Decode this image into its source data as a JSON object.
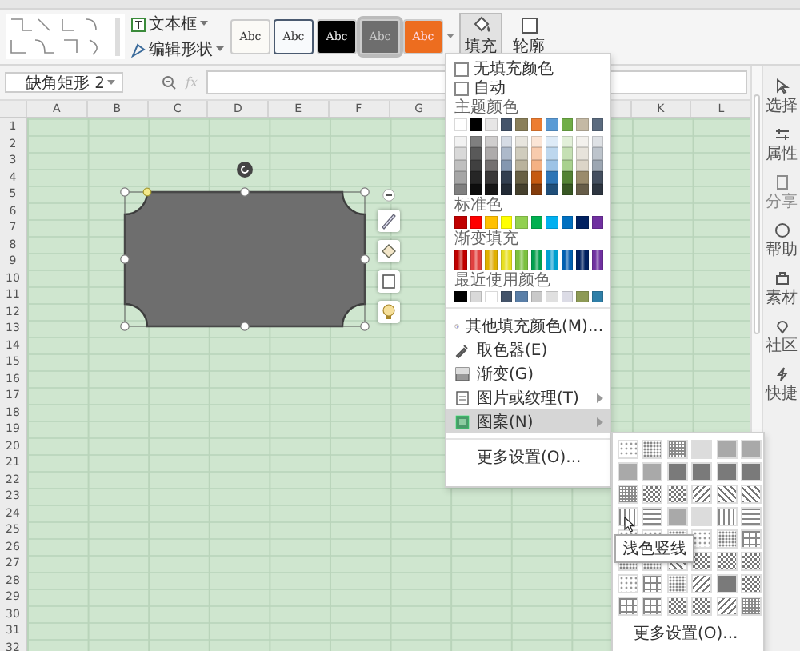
{
  "ribbon": {
    "tools": [
      {
        "label": "文本框",
        "kind": "textbox"
      },
      {
        "label": "编辑形状",
        "kind": "edit"
      }
    ],
    "styles": [
      {
        "label": "Abc",
        "kind": "light",
        "selected": false
      },
      {
        "label": "Abc",
        "kind": "outline",
        "selected": false
      },
      {
        "label": "Abc",
        "kind": "dark",
        "selected": false
      },
      {
        "label": "Abc",
        "kind": "gray",
        "selected": true
      },
      {
        "label": "Abc",
        "kind": "orange",
        "selected": false
      }
    ],
    "fill_button": {
      "label": "填充",
      "open": true
    },
    "outline_button": {
      "label": "轮廓",
      "open": false
    }
  },
  "formula_bar": {
    "name_box": "缺角矩形 2",
    "fx": "fx"
  },
  "sheet": {
    "columns_left": [
      "A",
      "B",
      "C",
      "D",
      "E",
      "F",
      "G"
    ],
    "columns_right": [
      "K",
      "L"
    ],
    "rows": [
      "1",
      "2",
      "3",
      "4",
      "5",
      "6",
      "7",
      "8",
      "9",
      "10",
      "11",
      "12",
      "13",
      "14",
      "15",
      "16",
      "17",
      "18",
      "19",
      "20",
      "21",
      "22",
      "23",
      "24",
      "25",
      "26",
      "27",
      "28",
      "29",
      "30",
      "31",
      "32"
    ]
  },
  "fill_menu": {
    "options": [
      {
        "label": "无填充颜色",
        "checked": false
      },
      {
        "label": "自动",
        "checked": false
      }
    ],
    "theme_label": "主题颜色",
    "theme_rows": [
      [
        {
          "color": "#ffffff"
        },
        {
          "color": "#000000"
        },
        {
          "color": "#e7e6e6"
        },
        {
          "color": "#44546a"
        },
        {
          "color": "#8a7f5a"
        },
        {
          "color": "#ed7d31"
        },
        {
          "color": "#5b9bd5"
        },
        {
          "color": "#70ad47"
        },
        {
          "color": "#c4b9a4"
        },
        {
          "color": "#5b6b7f"
        }
      ],
      [
        {
          "color": "#f2f2f2"
        },
        {
          "color": "#7f7f7f"
        },
        {
          "color": "#d0cece"
        },
        {
          "color": "#d6dce5"
        },
        {
          "color": "#e8e5de"
        },
        {
          "color": "#fbe5d6"
        },
        {
          "color": "#deebf7"
        },
        {
          "color": "#e2f0d9"
        },
        {
          "color": "#f3f1ed"
        },
        {
          "color": "#dee1e5"
        }
      ],
      [
        {
          "color": "#d9d9d9"
        },
        {
          "color": "#595959"
        },
        {
          "color": "#aeabab"
        },
        {
          "color": "#adb9ca"
        },
        {
          "color": "#d0ccbd"
        },
        {
          "color": "#f8cbad"
        },
        {
          "color": "#bdd7ee"
        },
        {
          "color": "#c5e0b4"
        },
        {
          "color": "#e7e3db"
        },
        {
          "color": "#bdc4cc"
        }
      ],
      [
        {
          "color": "#bfbfbf"
        },
        {
          "color": "#404040"
        },
        {
          "color": "#757171"
        },
        {
          "color": "#8497b0"
        },
        {
          "color": "#b9b29c"
        },
        {
          "color": "#f4b183"
        },
        {
          "color": "#9dc3e6"
        },
        {
          "color": "#a9d18e"
        },
        {
          "color": "#dcd5c8"
        },
        {
          "color": "#9ca6b2"
        }
      ],
      [
        {
          "color": "#a6a6a6"
        },
        {
          "color": "#262626"
        },
        {
          "color": "#3a3838"
        },
        {
          "color": "#333f50"
        },
        {
          "color": "#686044"
        },
        {
          "color": "#c55a11"
        },
        {
          "color": "#2e75b6"
        },
        {
          "color": "#548235"
        },
        {
          "color": "#9a8b6c"
        },
        {
          "color": "#444f5f"
        }
      ],
      [
        {
          "color": "#808080"
        },
        {
          "color": "#0d0d0d"
        },
        {
          "color": "#171616"
        },
        {
          "color": "#222a35"
        },
        {
          "color": "#45402d"
        },
        {
          "color": "#843c0c"
        },
        {
          "color": "#1f4e79"
        },
        {
          "color": "#385723"
        },
        {
          "color": "#675d48"
        },
        {
          "color": "#2d3540"
        }
      ]
    ],
    "standard_label": "标准色",
    "standard": [
      {
        "color": "#c00000"
      },
      {
        "color": "#ff0000"
      },
      {
        "color": "#ffc000"
      },
      {
        "color": "#ffff00"
      },
      {
        "color": "#92d050"
      },
      {
        "color": "#00b050"
      },
      {
        "color": "#00b0f0"
      },
      {
        "color": "#0070c0"
      },
      {
        "color": "#002060"
      },
      {
        "color": "#7030a0"
      }
    ],
    "gradient_label": "渐变填充",
    "gradient": [
      {
        "color": "#c00000"
      },
      {
        "color": "#e04040"
      },
      {
        "color": "#e0b000"
      },
      {
        "color": "#e8e020"
      },
      {
        "color": "#7cc040"
      },
      {
        "color": "#00a050"
      },
      {
        "color": "#00a0d0"
      },
      {
        "color": "#0060b0"
      },
      {
        "color": "#002060"
      },
      {
        "color": "#7030a0"
      }
    ],
    "recent_label": "最近使用颜色",
    "recent": [
      {
        "color": "#000000"
      },
      {
        "color": "#d9d9d9"
      },
      {
        "color": "#ffffff"
      },
      {
        "color": "#44546a"
      },
      {
        "color": "#5a7fa8"
      },
      {
        "color": "#c9c9c9"
      },
      {
        "color": "#e0e0e0"
      },
      {
        "color": "#dcdce6"
      },
      {
        "color": "#8d9a55"
      },
      {
        "color": "#2f7fa8"
      }
    ],
    "items": [
      {
        "label": "其他填充颜色(M)...",
        "kind": "palette",
        "submenu": false,
        "selected": false
      },
      {
        "label": "取色器(E)",
        "kind": "eyedropper",
        "submenu": false,
        "selected": false
      },
      {
        "label": "渐变(G)",
        "kind": "gradient",
        "submenu": false,
        "selected": false
      },
      {
        "label": "图片或纹理(T)",
        "kind": "picture",
        "submenu": true,
        "selected": false
      },
      {
        "label": "图案(N)",
        "kind": "pattern",
        "submenu": true,
        "selected": true
      }
    ],
    "more": "更多设置(O)..."
  },
  "pattern_menu": {
    "tooltip": "浅色竖线",
    "more": "更多设置(O)..."
  },
  "sidebar": [
    {
      "label": "选择",
      "kind": "select",
      "disabled": false
    },
    {
      "label": "属性",
      "kind": "sliders",
      "disabled": false
    },
    {
      "label": "分享",
      "kind": "doc",
      "disabled": true
    },
    {
      "label": "帮助",
      "kind": "help",
      "disabled": false
    },
    {
      "label": "素材",
      "kind": "bag",
      "disabled": false
    },
    {
      "label": "社区",
      "kind": "pin",
      "disabled": false
    },
    {
      "label": "快捷",
      "kind": "bolt",
      "disabled": false
    }
  ]
}
